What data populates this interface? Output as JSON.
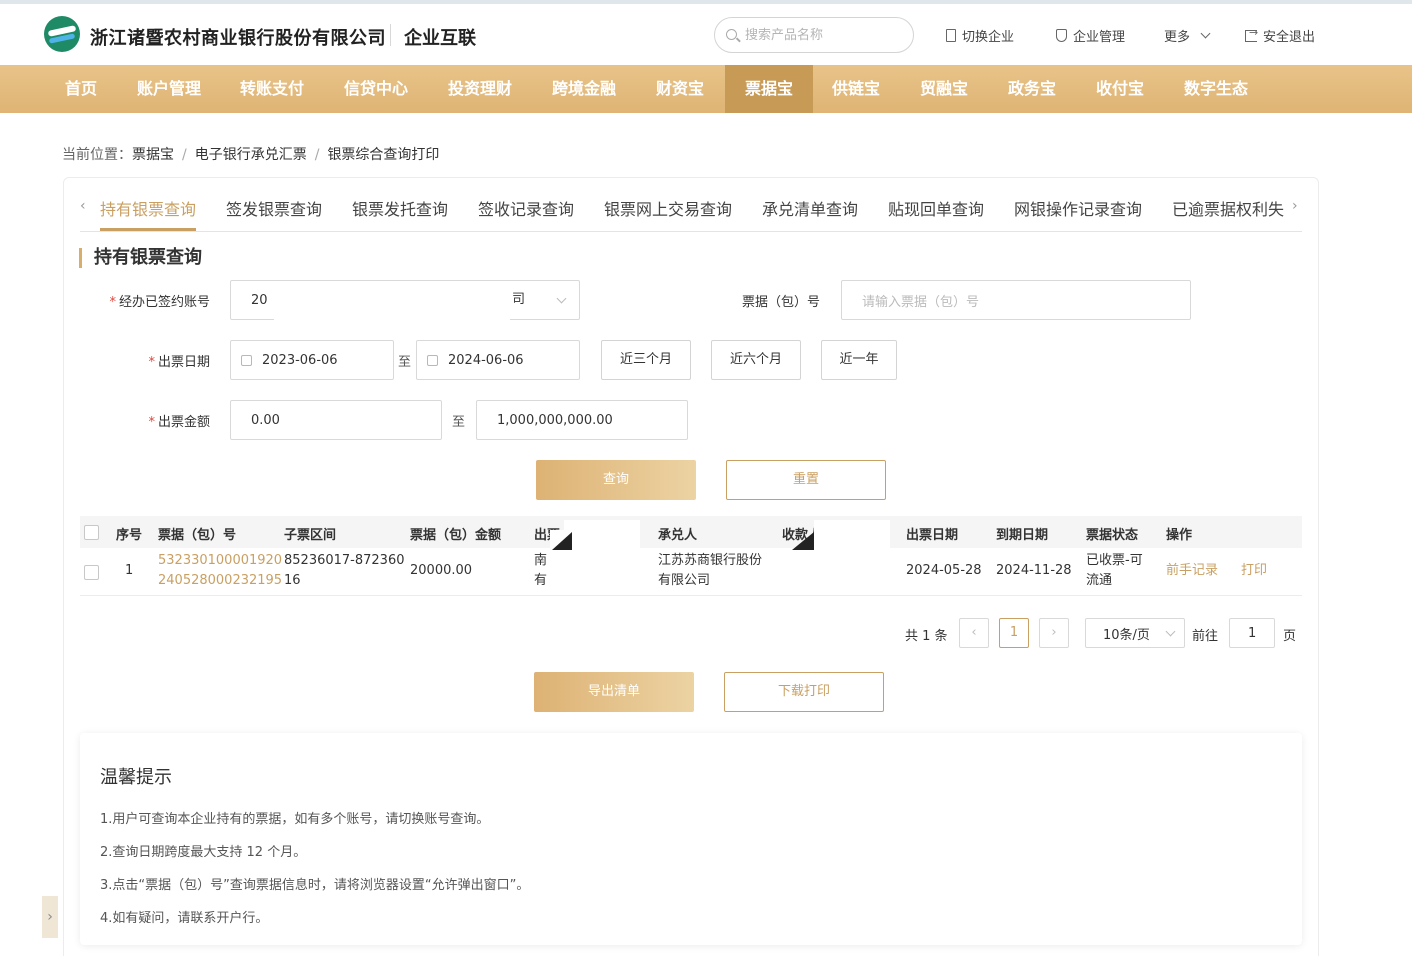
{
  "header": {
    "bank_name": "浙江诸暨农村商业银行股份有限公司",
    "portal_name": "企业互联",
    "search_placeholder": "搜索产品名称",
    "links": {
      "switch_company": "切换企业",
      "company_mgmt": "企业管理",
      "more": "更多",
      "logout": "安全退出"
    }
  },
  "nav": {
    "items": [
      "首页",
      "账户管理",
      "转账支付",
      "信贷中心",
      "投资理财",
      "跨境金融",
      "财资宝",
      "票据宝",
      "供链宝",
      "贸融宝",
      "政务宝",
      "收付宝",
      "数字生态"
    ],
    "active_index": 7
  },
  "breadcrumb": {
    "prefix": "当前位置：",
    "items": [
      "票据宝",
      "电子银行承兑汇票",
      "银票综合查询打印"
    ],
    "separator": "/"
  },
  "tabs": {
    "items": [
      "持有银票查询",
      "签发银票查询",
      "银票发托查询",
      "签收记录查询",
      "银票网上交易查询",
      "承兑清单查询",
      "贴现回单查询",
      "网银操作记录查询",
      "已逾票据权利失"
    ],
    "active_index": 0
  },
  "section_title": "持有银票查询",
  "form": {
    "account_label": "经办已签约账号",
    "account_value_prefix": "20",
    "account_value_suffix": "司",
    "bill_no_label": "票据（包）号",
    "bill_no_placeholder": "请输入票据（包）号",
    "date_label": "出票日期",
    "date_from": "2023-06-06",
    "date_to": "2024-06-06",
    "range_sep": "至",
    "quick_ranges": [
      "近三个月",
      "近六个月",
      "近一年"
    ],
    "amount_label": "出票金额",
    "amount_from": "0.00",
    "amount_to": "1,000,000,000.00",
    "query_button": "查询",
    "reset_button": "重置"
  },
  "table": {
    "columns": [
      "序号",
      "票据（包）号",
      "子票区间",
      "票据（包）金额",
      "出票人",
      "承兑人",
      "收款人",
      "出票日期",
      "到期日期",
      "票据状态",
      "操作"
    ],
    "rows": [
      {
        "index": "1",
        "bill_no_line1": "532330100001920",
        "bill_no_line2": "240528000232195",
        "sub_range_line1": "85236017-872360",
        "sub_range_line2": "16",
        "amount": "20000.00",
        "drawer_line1": "南",
        "drawer_line2": "有",
        "acceptor_line1": "江苏苏商银行股份",
        "acceptor_line2": "有限公司",
        "issue_date": "2024-05-28",
        "due_date": "2024-11-28",
        "status_line1": "已收票-可",
        "status_line2": "流通",
        "actions": [
          "前手记录",
          "打印"
        ]
      }
    ]
  },
  "pagination": {
    "total_text": "共 1 条",
    "current_page": "1",
    "page_size": "10条/页",
    "goto_label": "前往",
    "goto_value": "1",
    "page_unit": "页"
  },
  "bottom_buttons": {
    "export": "导出清单",
    "download": "下载打印"
  },
  "tips": {
    "title": "温馨提示",
    "items": [
      "1.用户可查询本企业持有的票据，如有多个账号，请切换账号查询。",
      "2.查询日期跨度最大支持 12 个月。",
      "3.点击“票据（包）号”查询票据信息时，请将浏览器设置“允许弹出窗口”。",
      "4.如有疑问，请联系开户行。"
    ]
  },
  "colors": {
    "nav_gradient_start": "#e8c389",
    "nav_active": "#c79a55",
    "accent_gold": "#c9a063",
    "required_red": "#e0463c"
  }
}
